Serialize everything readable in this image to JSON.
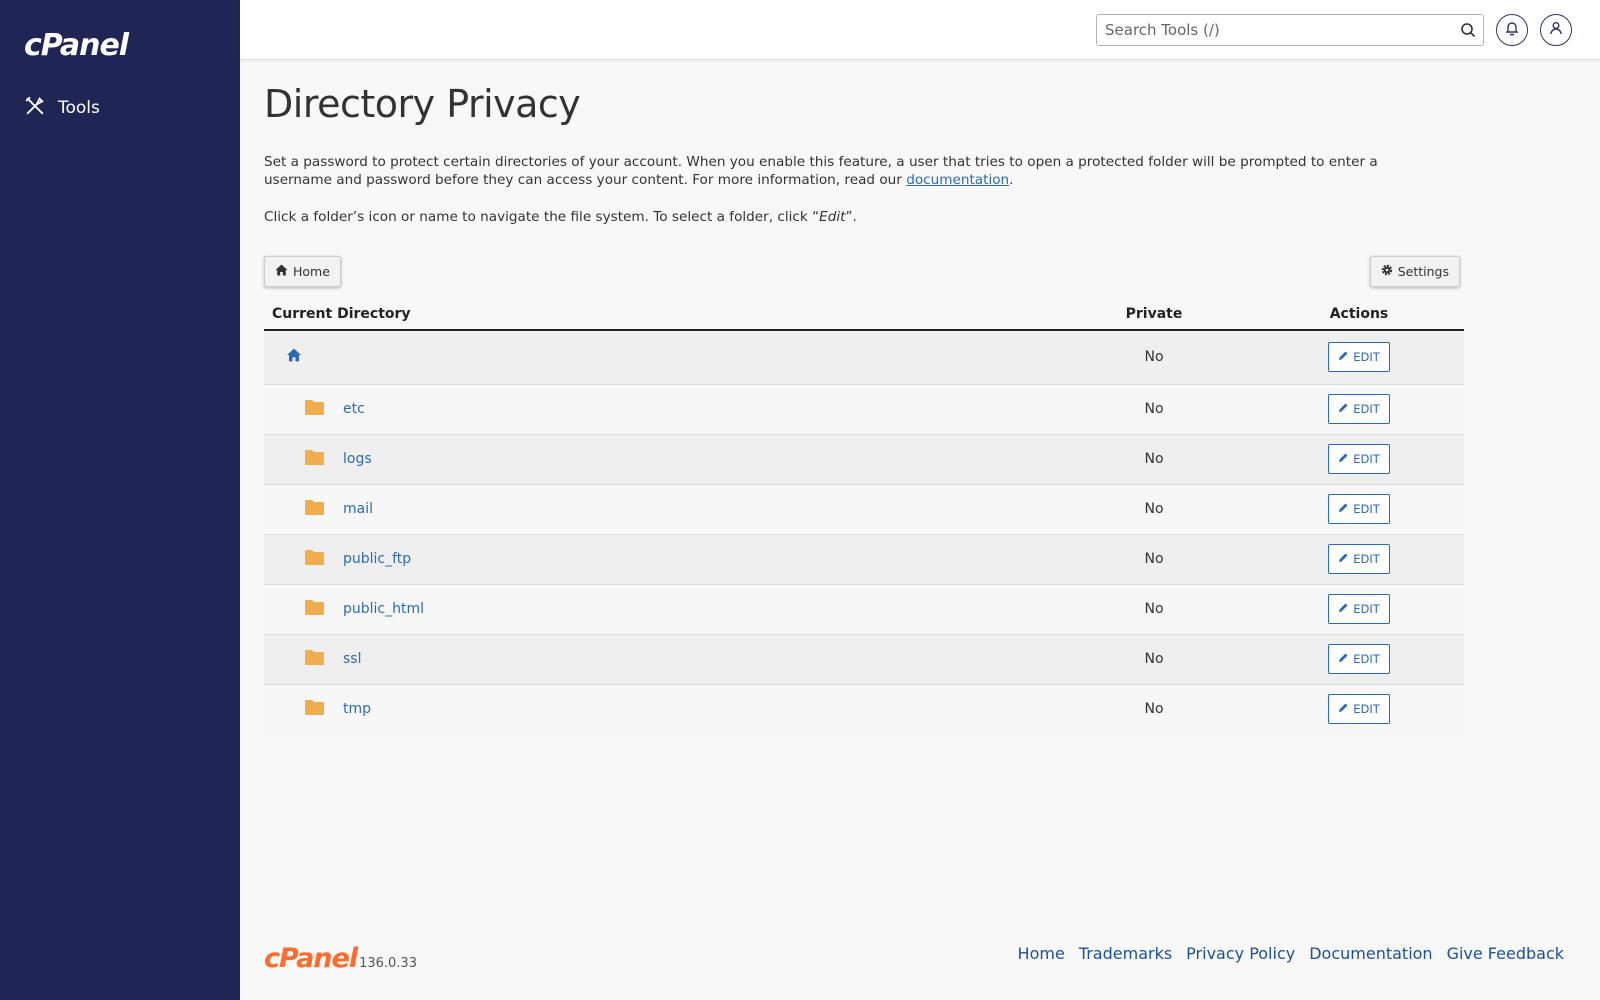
{
  "brand": {
    "logo_text": "cPanel",
    "version": "136.0.33"
  },
  "sidebar": {
    "items": [
      {
        "label": "Tools",
        "icon": "tools-icon"
      }
    ]
  },
  "topbar": {
    "search_placeholder": "Search Tools (/)",
    "notifications_icon": "bell-icon",
    "user_icon": "user-icon"
  },
  "page": {
    "title": "Directory Privacy",
    "description_before_link": "Set a password to protect certain directories of your account. When you enable this feature, a user that tries to open a protected folder will be prompted to enter a username and password before they can access your content. For more information, read our ",
    "description_link": "documentation",
    "description_after_link": ".",
    "hint_before": "Click a folder’s icon or name to navigate the file system. To select a folder, click “",
    "hint_em": "Edit",
    "hint_after": "”."
  },
  "toolbar": {
    "home_label": "Home",
    "settings_label": "Settings"
  },
  "table": {
    "headers": {
      "directory": "Current Directory",
      "private": "Private",
      "actions": "Actions"
    },
    "edit_label": "EDIT",
    "root": {
      "private": "No"
    },
    "rows": [
      {
        "name": "etc",
        "private": "No"
      },
      {
        "name": "logs",
        "private": "No"
      },
      {
        "name": "mail",
        "private": "No"
      },
      {
        "name": "public_ftp",
        "private": "No"
      },
      {
        "name": "public_html",
        "private": "No"
      },
      {
        "name": "ssl",
        "private": "No"
      },
      {
        "name": "tmp",
        "private": "No"
      }
    ]
  },
  "footer": {
    "links": [
      "Home",
      "Trademarks",
      "Privacy Policy",
      "Documentation",
      "Give Feedback"
    ]
  },
  "colors": {
    "sidebar": "#1f2554",
    "link": "#2e6ab2",
    "folder": "#f0ad4e",
    "brand_orange": "#ff6c2c"
  }
}
